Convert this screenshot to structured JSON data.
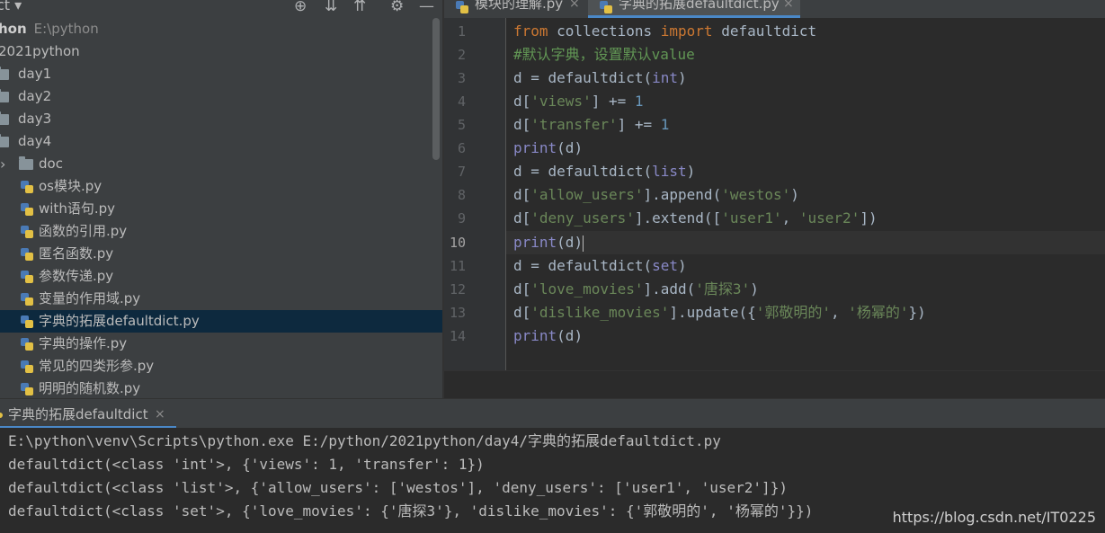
{
  "project_panel": {
    "title": "ct",
    "tree": [
      {
        "label": "hon",
        "sub": "E:\\python",
        "type": "root"
      },
      {
        "label": "2021python",
        "type": "folder-plain"
      },
      {
        "label": "day1",
        "type": "folder"
      },
      {
        "label": "day2",
        "type": "folder"
      },
      {
        "label": "day3",
        "type": "folder"
      },
      {
        "label": "day4",
        "type": "folder"
      },
      {
        "label": "doc",
        "type": "folder-child"
      },
      {
        "label": "os模块.py",
        "type": "file"
      },
      {
        "label": "with语句.py",
        "type": "file"
      },
      {
        "label": "函数的引用.py",
        "type": "file"
      },
      {
        "label": "匿名函数.py",
        "type": "file"
      },
      {
        "label": "参数传递.py",
        "type": "file"
      },
      {
        "label": "变量的作用域.py",
        "type": "file"
      },
      {
        "label": "字典的拓展defaultdict.py",
        "type": "file",
        "selected": true
      },
      {
        "label": "字典的操作.py",
        "type": "file"
      },
      {
        "label": "常见的四类形参.py",
        "type": "file"
      },
      {
        "label": "明明的随机数.py",
        "type": "file"
      }
    ]
  },
  "editor": {
    "tabs": [
      {
        "label": "模块的理解.py",
        "close": "×"
      },
      {
        "label": "字典的拓展defaultdict.py",
        "close": "×",
        "active": true
      }
    ],
    "current_line": 10,
    "lines": [
      {
        "n": "1"
      },
      {
        "n": "2"
      },
      {
        "n": "3"
      },
      {
        "n": "4"
      },
      {
        "n": "5"
      },
      {
        "n": "6"
      },
      {
        "n": "7"
      },
      {
        "n": "8"
      },
      {
        "n": "9"
      },
      {
        "n": "10"
      },
      {
        "n": "11"
      },
      {
        "n": "12"
      },
      {
        "n": "13"
      },
      {
        "n": "14"
      }
    ],
    "code": {
      "l1": [
        "from",
        " collections ",
        "import",
        " defaultdict"
      ],
      "l2": "#默认字典，设置默认value",
      "l3": [
        "d = defaultdict(",
        "int",
        ")"
      ],
      "l4": [
        "d[",
        "'views'",
        "] += ",
        "1"
      ],
      "l5": [
        "d[",
        "'transfer'",
        "] += ",
        "1"
      ],
      "l6": [
        "print",
        "(d)"
      ],
      "l7": [
        "d = defaultdict(",
        "list",
        ")"
      ],
      "l8": [
        "d[",
        "'allow_users'",
        "].append(",
        "'westos'",
        ")"
      ],
      "l9": [
        "d[",
        "'deny_users'",
        "].extend([",
        "'user1'",
        ", ",
        "'user2'",
        "])"
      ],
      "l10": [
        "print",
        "(d)"
      ],
      "l11": [
        "d = defaultdict(",
        "set",
        ")"
      ],
      "l12": [
        "d[",
        "'love_movies'",
        "].add(",
        "'唐探3'",
        ")"
      ],
      "l13": [
        "d[",
        "'dislike_movies'",
        "].update({",
        "'郭敬明的'",
        ", ",
        "'杨幂的'",
        "})"
      ],
      "l14": [
        "print",
        "(d)"
      ]
    }
  },
  "run_panel": {
    "tab_label": "字典的拓展defaultdict",
    "tab_close": "×",
    "output": [
      "E:\\python\\venv\\Scripts\\python.exe E:/python/2021python/day4/字典的拓展defaultdict.py",
      "defaultdict(<class 'int'>, {'views': 1, 'transfer': 1})",
      "defaultdict(<class 'list'>, {'allow_users': ['westos'], 'deny_users': ['user1', 'user2']})",
      "defaultdict(<class 'set'>, {'love_movies': {'唐探3'}, 'dislike_movies': {'郭敬明的', '杨幂的'}})"
    ]
  },
  "watermark": "https://blog.csdn.net/IT0225",
  "icons": {
    "dropdown": "▾",
    "locate": "⊕",
    "expand": "⇊",
    "collapse": "⇈",
    "settings": "⚙",
    "hide": "—",
    "tree_expand": "›"
  },
  "colors": {
    "keyword": "#cc7832",
    "string": "#6a8759",
    "number": "#6897bb",
    "builtin": "#8888c6",
    "comment": "#629755",
    "selection": "#0d293e",
    "tab_accent": "#4a88c7"
  }
}
